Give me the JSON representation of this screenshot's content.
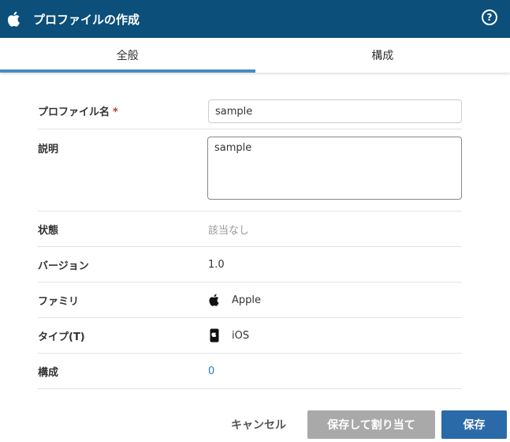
{
  "header": {
    "title": "プロファイルの作成",
    "logo_icon": "apple-logo-icon",
    "help_label": "?"
  },
  "tabs": [
    {
      "label": "全般",
      "active": true
    },
    {
      "label": "構成",
      "active": false
    }
  ],
  "form": {
    "profile_name": {
      "label": "プロファイル名",
      "required_mark": "*",
      "value": "sample"
    },
    "description": {
      "label": "説明",
      "value": "sample"
    },
    "status": {
      "label": "状態",
      "value": "該当なし"
    },
    "version": {
      "label": "バージョン",
      "value": "1.0"
    },
    "family": {
      "label": "ファミリ",
      "value": "Apple",
      "icon": "apple-icon"
    },
    "type": {
      "label": "タイプ(T)",
      "value": "iOS",
      "icon": "mobile-device-icon"
    },
    "configuration": {
      "label": "構成",
      "value": "0"
    }
  },
  "buttons": {
    "cancel": "キャンセル",
    "save_and_assign": "保存して割り当て",
    "save": "保存"
  },
  "colors": {
    "header_bg": "#0b4f7a",
    "tab_indicator": "#4a8bc2",
    "save_button": "#2a6aa8",
    "disabled_button": "#a9a9a9",
    "required": "#c0392b",
    "link": "#2a7ab8"
  }
}
